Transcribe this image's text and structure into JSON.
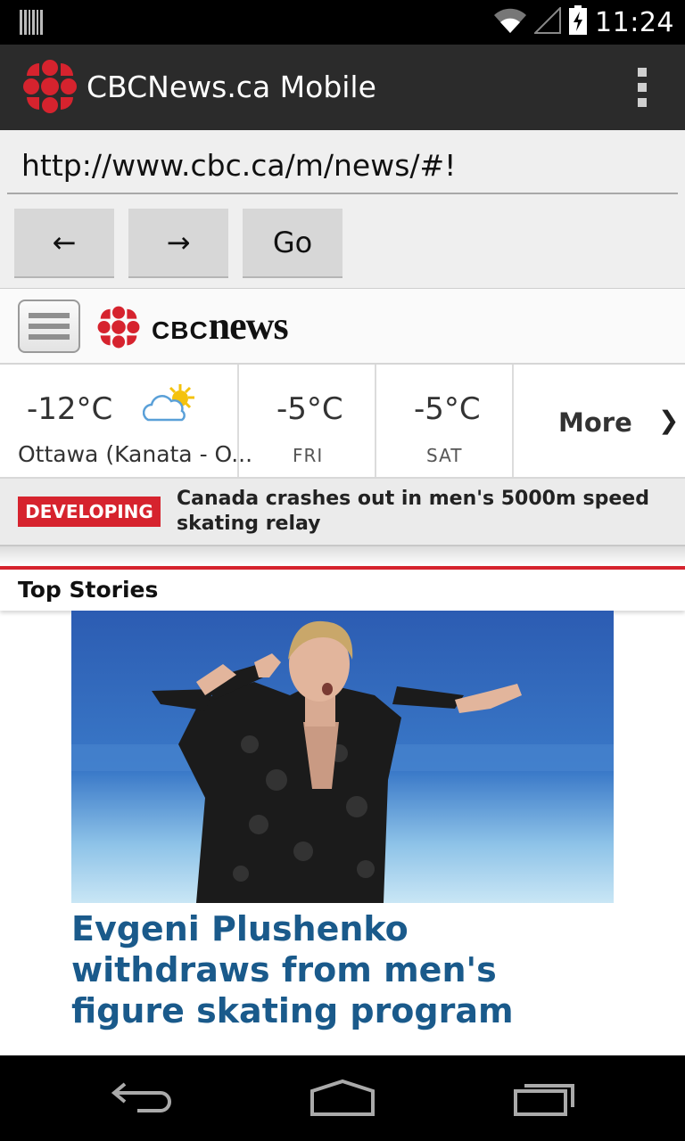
{
  "status_bar": {
    "time": "11:24",
    "icons": [
      "barcode-notification-icon",
      "wifi-icon",
      "signal-icon",
      "battery-charging-icon"
    ]
  },
  "app_bar": {
    "title": "CBCNews.ca Mobile",
    "logo_icon": "cbc-gem-logo",
    "menu_icon": "overflow-menu-icon"
  },
  "browser": {
    "url": "http://www.cbc.ca/m/news/#!",
    "back_label": "←",
    "forward_label": "→",
    "go_label": "Go"
  },
  "site": {
    "menu_icon": "hamburger-icon",
    "logo_cbc": "CBC",
    "logo_news": "news"
  },
  "weather": {
    "current": {
      "temp": "-12°C",
      "city": "Ottawa (Kanata - O...",
      "icon": "partly-sunny-icon"
    },
    "days": [
      {
        "temp": "-5°C",
        "day": "FRI"
      },
      {
        "temp": "-5°C",
        "day": "SAT"
      }
    ],
    "more_label": "More",
    "more_chevron": "❯"
  },
  "developing": {
    "badge": "DEVELOPING",
    "text": "Canada crashes out in men's 5000m speed skating relay"
  },
  "top_stories": {
    "label": "Top Stories",
    "headline": "Evgeni Plushenko withdraws from men's figure skating program",
    "image_alt": "figure-skater-photo"
  },
  "colors": {
    "cbc_red": "#d6232e",
    "headline_blue": "#1a5a8b",
    "action_bar": "#2b2b2b"
  }
}
